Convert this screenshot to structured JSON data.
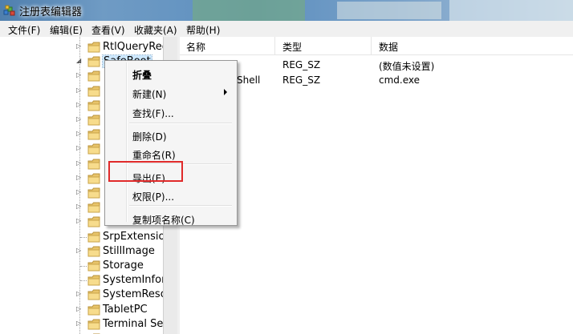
{
  "window": {
    "title": "注册表编辑器",
    "app_icon": "regedit-icon"
  },
  "menubar": {
    "items": [
      "文件(F)",
      "编辑(E)",
      "查看(V)",
      "收藏夹(A)",
      "帮助(H)"
    ]
  },
  "tree": {
    "items": [
      {
        "label": "RtlQueryReg",
        "expander": "collapsed"
      },
      {
        "label": "SafeBoot",
        "expander": "expanded",
        "selected": true
      },
      {
        "label": "",
        "expander": "collapsed"
      },
      {
        "label": "",
        "expander": "collapsed"
      },
      {
        "label": "",
        "expander": "collapsed"
      },
      {
        "label": "",
        "expander": "collapsed"
      },
      {
        "label": "",
        "expander": "collapsed"
      },
      {
        "label": "",
        "expander": "collapsed"
      },
      {
        "label": "",
        "expander": "collapsed"
      },
      {
        "label": "",
        "expander": "collapsed"
      },
      {
        "label": "",
        "expander": "collapsed"
      },
      {
        "label": "",
        "expander": "collapsed"
      },
      {
        "label": "",
        "expander": "collapsed"
      },
      {
        "label": "SrpExtension",
        "expander": "none"
      },
      {
        "label": "StillImage",
        "expander": "collapsed"
      },
      {
        "label": "Storage",
        "expander": "none"
      },
      {
        "label": "SystemInforr",
        "expander": "none"
      },
      {
        "label": "SystemResou",
        "expander": "collapsed"
      },
      {
        "label": "TabletPC",
        "expander": "collapsed"
      },
      {
        "label": "Terminal Ser",
        "expander": "collapsed"
      },
      {
        "label": "",
        "expander": "collapsed"
      }
    ]
  },
  "list": {
    "columns": [
      "名称",
      "类型",
      "数据"
    ],
    "rows": [
      {
        "name": "",
        "type": "REG_SZ",
        "data": "(数值未设置)"
      },
      {
        "name": "Shell",
        "type": "REG_SZ",
        "data": "cmd.exe"
      }
    ]
  },
  "context_menu": {
    "items": [
      {
        "label": "折叠",
        "bold": true
      },
      {
        "label": "新建(N)",
        "submenu": true
      },
      {
        "label": "查找(F)..."
      },
      {
        "label": "删除(D)"
      },
      {
        "label": "重命名(R)"
      },
      {
        "label": "导出(E)",
        "highlighted": true
      },
      {
        "label": "权限(P)..."
      },
      {
        "label": "复制项名称(C)"
      }
    ],
    "highlight_color": "#e02a2a"
  }
}
